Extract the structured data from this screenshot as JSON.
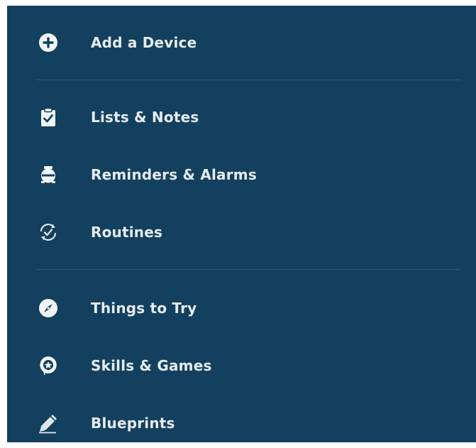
{
  "colors": {
    "panel_background": "#13405e",
    "text": "#e6ecf1",
    "divider": "#2e5978"
  },
  "menu": {
    "items": [
      {
        "label": "Add a Device",
        "icon": "plus-circle-icon"
      },
      {
        "label": "Lists & Notes",
        "icon": "clipboard-check-icon"
      },
      {
        "label": "Reminders & Alarms",
        "icon": "alarm-clock-icon"
      },
      {
        "label": "Routines",
        "icon": "routine-check-icon"
      },
      {
        "label": "Things to Try",
        "icon": "compass-icon"
      },
      {
        "label": "Skills & Games",
        "icon": "skills-bubble-icon"
      },
      {
        "label": "Blueprints",
        "icon": "pencil-icon"
      }
    ]
  }
}
